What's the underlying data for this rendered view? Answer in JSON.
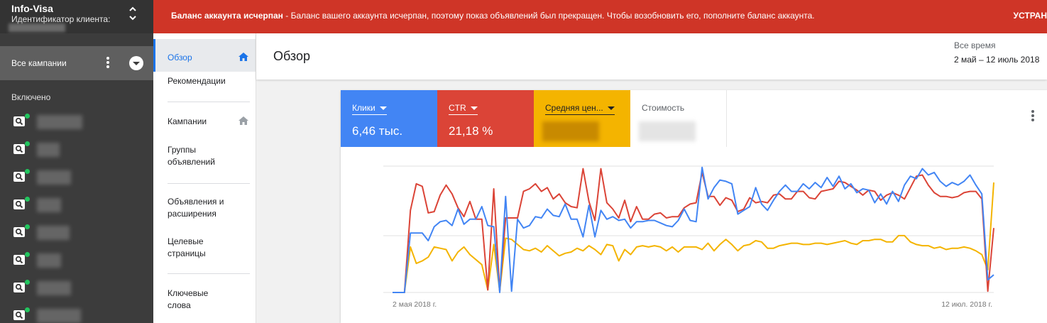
{
  "account": {
    "name": "Info-Visa",
    "id_label": "Идентификатор клиента:"
  },
  "sidebar": {
    "all_campaigns": "Все кампании",
    "section_enabled": "Включено",
    "campaigns": [
      {
        "icon": "search-icon",
        "status": "enabled"
      },
      {
        "icon": "search-icon",
        "status": "enabled"
      },
      {
        "icon": "search-icon",
        "status": "enabled"
      },
      {
        "icon": "search-icon",
        "status": "enabled"
      },
      {
        "icon": "search-icon",
        "status": "enabled"
      },
      {
        "icon": "search-icon",
        "status": "enabled"
      },
      {
        "icon": "search-icon",
        "status": "enabled"
      },
      {
        "icon": "search-icon",
        "status": "enabled"
      }
    ]
  },
  "alert": {
    "title": "Баланс аккаунта исчерпан",
    "message": " - Баланс вашего аккаунта исчерпан, поэтому показ объявлений был прекращен. Чтобы возобновить его, пополните баланс аккаунта.",
    "action": "УСТРАН"
  },
  "nav": {
    "overview": "Обзор",
    "recommendations": "Рекомендации",
    "campaigns": "Кампании",
    "ad_groups": "Группы объявлений",
    "ads": "Объявления и расширения",
    "landing_pages": "Целевые страницы",
    "keywords": "Ключевые слова"
  },
  "header": {
    "title": "Обзор",
    "range_label": "Все время",
    "range_value": "2 май – 12 июль 2018"
  },
  "metrics": [
    {
      "label": "Клики",
      "value": "6,46 тыс.",
      "color": "#4285f4"
    },
    {
      "label": "CTR",
      "value": "21,18 %",
      "color": "#db4437"
    },
    {
      "label": "Средняя цен...",
      "value": "",
      "color": "#f4b400"
    },
    {
      "label": "Стоимость",
      "value": "",
      "color": "#ffffff"
    }
  ],
  "chart_data": {
    "type": "line",
    "x_start_label": "2 мая 2018 г.",
    "x_end_label": "12 июл. 2018 г.",
    "grid": true,
    "y_axis": "hidden",
    "series": [
      {
        "name": "Клики",
        "color": "#4285f4",
        "values": [
          0,
          0,
          0,
          0.47,
          0.47,
          0.47,
          0.41,
          0.52,
          0.56,
          0.57,
          0.53,
          0.66,
          0.54,
          0.58,
          0.58,
          0.68,
          0.53,
          0.52,
          0,
          0.76,
          0.01,
          0.58,
          0.51,
          0.53,
          0.6,
          0.59,
          0.66,
          0.61,
          0.6,
          0.7,
          0.58,
          0.58,
          0.44,
          0.69,
          0.44,
          0.65,
          0.58,
          0.6,
          0.57,
          0.58,
          0.51,
          0.56,
          0.56,
          0.57,
          0.57,
          0.55,
          0.53,
          0.52,
          0.57,
          0.66,
          0.57,
          0.56,
          0.99,
          0.74,
          0.83,
          0.89,
          0.88,
          0.86,
          0.62,
          0.65,
          0.68,
          0.83,
          0.7,
          0.65,
          0.73,
          0.8,
          0.85,
          0.8,
          0.8,
          0.86,
          0.82,
          0.87,
          0.83,
          0.91,
          0.84,
          0.92,
          0.82,
          0.86,
          0.79,
          0.82,
          0.81,
          0.71,
          0.78,
          0.7,
          0.8,
          0.72,
          0.85,
          0.92,
          0.9,
          0.98,
          0.93,
          0.95,
          0.88,
          0.84,
          0.87,
          0.85,
          0.88,
          0.93,
          0.85,
          0.78,
          0.1,
          0.14
        ]
      },
      {
        "name": "CTR",
        "color": "#db4437",
        "values": [
          0,
          0,
          0,
          0.65,
          0.86,
          0.84,
          0.63,
          0.64,
          0.77,
          0.85,
          0.78,
          0.67,
          0.6,
          0.72,
          0.58,
          0.58,
          0.02,
          0.82,
          0.01,
          0.59,
          0.59,
          0.59,
          0.8,
          0.82,
          0.86,
          0.8,
          0.83,
          0.74,
          0.78,
          0.71,
          0.68,
          0.67,
          0.98,
          0.72,
          0.57,
          0.98,
          0.71,
          0.66,
          0.59,
          0.73,
          0.56,
          0.68,
          0.58,
          0.58,
          0.62,
          0.63,
          0.59,
          0.6,
          0.6,
          0.67,
          0.7,
          0.71,
          0.95,
          0.76,
          0.76,
          0.69,
          0.75,
          0.73,
          0.64,
          0.66,
          0.75,
          0.71,
          0.72,
          0.71,
          0.77,
          0.78,
          0.74,
          0.74,
          0.8,
          0.8,
          0.75,
          0.74,
          0.8,
          0.81,
          0.82,
          0.88,
          0.87,
          0.84,
          0.81,
          0.77,
          0.81,
          0.8,
          0.73,
          0.77,
          0.79,
          0.77,
          0.74,
          0.83,
          0.92,
          0.93,
          0.85,
          0.79,
          0.76,
          0.76,
          0.75,
          0.76,
          0.79,
          0.8,
          0.8,
          0.74,
          0.01,
          0.51
        ]
      },
      {
        "name": "Средняя цена",
        "color": "#f4b400",
        "values": [
          0,
          0,
          0,
          0.36,
          0.23,
          0.25,
          0.28,
          0.36,
          0.35,
          0.34,
          0.25,
          0.32,
          0.36,
          0.3,
          0.26,
          0.22,
          0.02,
          0.38,
          0.01,
          0.43,
          0.42,
          0.38,
          0.34,
          0.33,
          0.35,
          0.32,
          0.37,
          0.33,
          0.29,
          0.31,
          0.32,
          0.35,
          0.33,
          0.37,
          0.34,
          0.3,
          0.38,
          0.37,
          0.25,
          0.34,
          0.3,
          0.36,
          0.37,
          0.36,
          0.37,
          0.36,
          0.33,
          0.36,
          0.32,
          0.36,
          0.36,
          0.36,
          0.34,
          0.39,
          0.33,
          0.38,
          0.42,
          0.38,
          0.33,
          0.37,
          0.38,
          0.41,
          0.4,
          0.35,
          0.35,
          0.37,
          0.38,
          0.39,
          0.39,
          0.38,
          0.38,
          0.39,
          0.39,
          0.38,
          0.39,
          0.4,
          0.41,
          0.39,
          0.38,
          0.41,
          0.41,
          0.42,
          0.42,
          0.4,
          0.4,
          0.45,
          0.45,
          0.4,
          0.38,
          0.37,
          0.37,
          0.35,
          0.36,
          0.34,
          0.35,
          0.35,
          0.36,
          0.35,
          0.33,
          0.3,
          0.18,
          0.87
        ]
      }
    ]
  }
}
